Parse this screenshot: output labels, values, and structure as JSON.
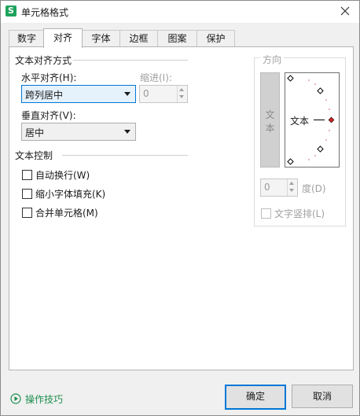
{
  "window": {
    "title": "单元格格式",
    "app_icon_text": "S"
  },
  "tabs": [
    {
      "label": "数字"
    },
    {
      "label": "对齐"
    },
    {
      "label": "字体"
    },
    {
      "label": "边框"
    },
    {
      "label": "图案"
    },
    {
      "label": "保护"
    }
  ],
  "alignment": {
    "section_title": "文本对齐方式",
    "horizontal_label": "水平对齐(H):",
    "horizontal_value": "跨列居中",
    "indent_label": "缩进(I):",
    "indent_value": "0",
    "vertical_label": "垂直对齐(V):",
    "vertical_value": "居中"
  },
  "text_control": {
    "section_title": "文本控制",
    "options": [
      {
        "label": "自动换行(W)",
        "checked": false
      },
      {
        "label": "缩小字体填充(K)",
        "checked": false
      },
      {
        "label": "合并单元格(M)",
        "checked": false
      }
    ]
  },
  "orientation": {
    "section_title": "方向",
    "vertical_text_chars": [
      "文",
      "本"
    ],
    "dial_text": "文本",
    "degree_value": "0",
    "degree_label": "度(D)",
    "vertical_checkbox_label": "文字竖排(L)"
  },
  "footer": {
    "tips_label": "操作技巧",
    "ok_label": "确定",
    "cancel_label": "取消"
  },
  "colors": {
    "accent": "#0078d7",
    "tips": "#1e8e4e",
    "app_icon": "#1ea35c",
    "dial_marker": "#cc2222"
  }
}
